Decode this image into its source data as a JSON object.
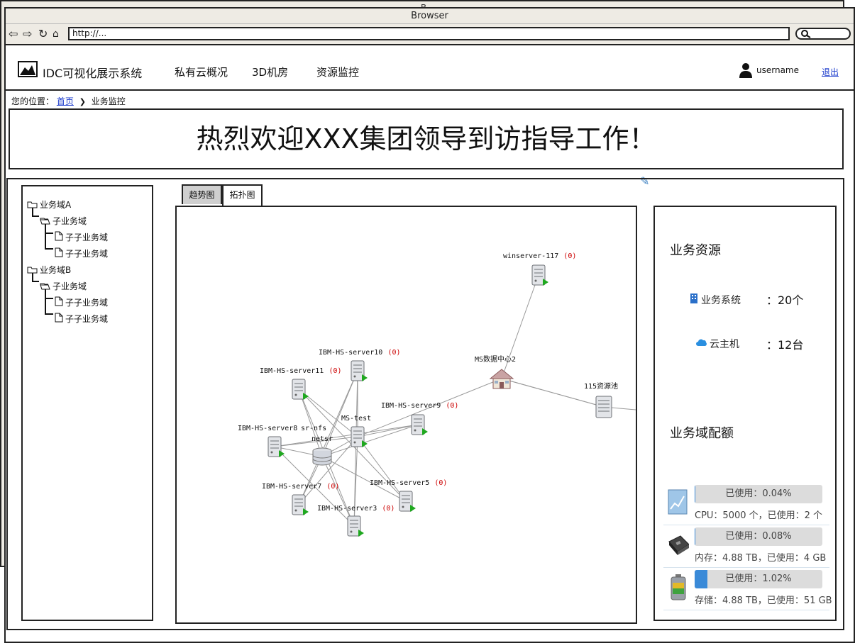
{
  "ghost_title": "B",
  "browser": {
    "title": "Browser",
    "url": "http://..."
  },
  "header": {
    "app_name": "IDC可视化展示系统",
    "nav": [
      "私有云概况",
      "3D机房",
      "资源监控"
    ],
    "username": "username",
    "logout": "退出"
  },
  "breadcrumb": {
    "prefix": "您的位置：",
    "home": "首页",
    "separator": "❯",
    "current": "业务监控"
  },
  "banner": {
    "text": "热烈欢迎XXX集团领导到访指导工作！"
  },
  "tree": [
    {
      "label": "业务域A",
      "icon": "folder-icon"
    },
    {
      "label": "子业务域",
      "icon": "folder-icon"
    },
    {
      "label": "子子业务域",
      "icon": "file-icon"
    },
    {
      "label": "子子业务域",
      "icon": "file-icon"
    },
    {
      "label": "业务域B",
      "icon": "folder-icon"
    },
    {
      "label": "子业务域",
      "icon": "folder-icon"
    },
    {
      "label": "子子业务域",
      "icon": "file-icon"
    },
    {
      "label": "子子业务域",
      "icon": "file-icon"
    }
  ],
  "tabs": {
    "trend": "趋势图",
    "topology": "拓扑图"
  },
  "topology": {
    "nodes": [
      {
        "id": "winserver",
        "label": "winserver-117",
        "count": "(0)",
        "kind": "server"
      },
      {
        "id": "dc",
        "label": "MS数据中心2",
        "count": "",
        "kind": "home"
      },
      {
        "id": "pool",
        "label": "115资源池",
        "count": "",
        "kind": "storage"
      },
      {
        "id": "s10",
        "label": "IBM-HS-server10",
        "count": "(0)",
        "kind": "server"
      },
      {
        "id": "s11",
        "label": "IBM-HS-server11",
        "count": "(0)",
        "kind": "server"
      },
      {
        "id": "s9",
        "label": "IBM-HS-server9",
        "count": "(0)",
        "kind": "server"
      },
      {
        "id": "mstest",
        "label": "MS-test",
        "count": "",
        "kind": "server"
      },
      {
        "id": "s8",
        "label": "IBM-HS-server8",
        "count": "",
        "kind": "server"
      },
      {
        "id": "srfs",
        "label": "sr-nfs",
        "count": "",
        "kind": "none"
      },
      {
        "id": "netsr",
        "label": "netsr",
        "count": "",
        "kind": "storage"
      },
      {
        "id": "s7",
        "label": "IBM-HS-server7",
        "count": "(0)",
        "kind": "server"
      },
      {
        "id": "s5",
        "label": "IBM-HS-server5",
        "count": "(0)",
        "kind": "server"
      },
      {
        "id": "s3",
        "label": "IBM-HS-server3",
        "count": "(0)",
        "kind": "server"
      }
    ]
  },
  "resources": {
    "title": "业务资源",
    "items": [
      {
        "label": "业务系统",
        "value": "：20个",
        "icon": "building-icon",
        "color": "#2a6fc9"
      },
      {
        "label": "云主机",
        "value": "：12台",
        "icon": "cloud-icon",
        "color": "#2a8fe0"
      }
    ]
  },
  "quota": {
    "title": "业务域配额",
    "items": [
      {
        "percent_label": "已使用：0.04%",
        "fraction": 0.0004,
        "desc": "CPU：5000 个，已使用：2 个",
        "icon": "cpu-chart-icon"
      },
      {
        "percent_label": "已使用：0.08%",
        "fraction": 0.0008,
        "desc": "内存：4.88 TB，已使用：4 GB",
        "icon": "memory-chip-icon"
      },
      {
        "percent_label": "已使用：1.02%",
        "fraction": 0.0102,
        "desc": "存储：4.88 TB，已使用：51 GB",
        "icon": "storage-battery-icon"
      }
    ]
  }
}
